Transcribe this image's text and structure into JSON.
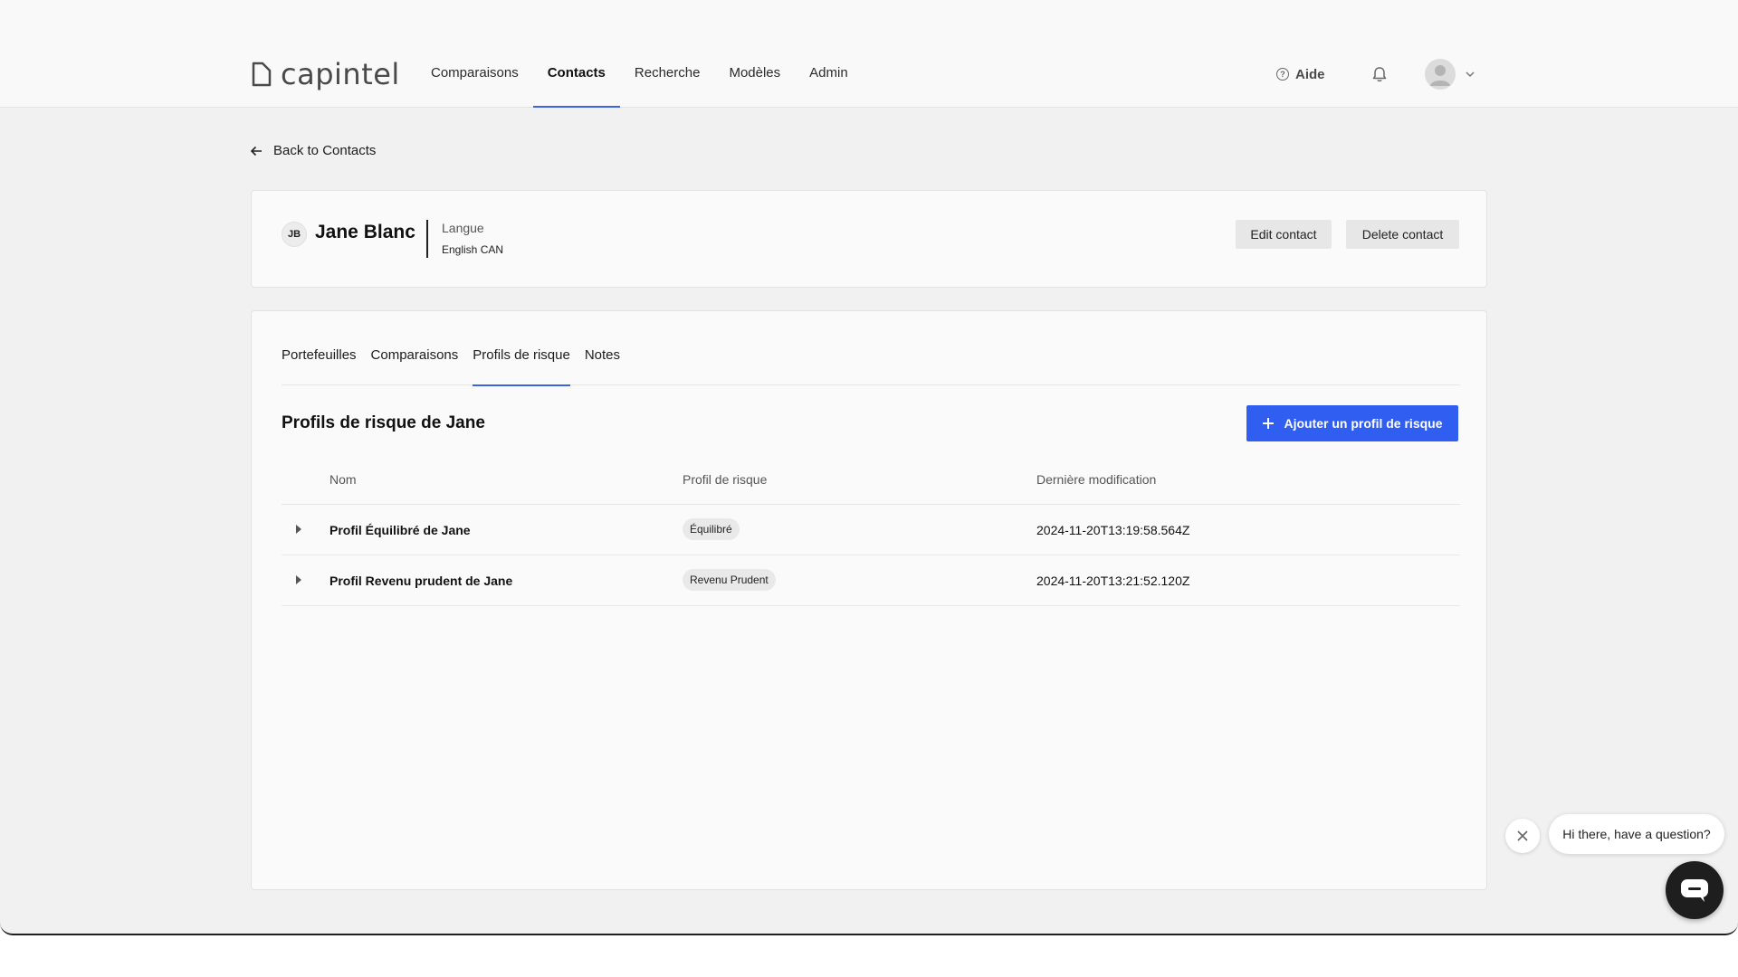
{
  "brand": {
    "name": "capintel"
  },
  "nav": {
    "items": [
      {
        "label": "Comparaisons",
        "active": false
      },
      {
        "label": "Contacts",
        "active": true
      },
      {
        "label": "Recherche",
        "active": false
      },
      {
        "label": "Modèles",
        "active": false
      },
      {
        "label": "Admin",
        "active": false
      }
    ]
  },
  "header_right": {
    "help_label": "Aide",
    "help_icon": "question-icon",
    "notify_icon": "bell-icon"
  },
  "back_link": {
    "label": "Back to Contacts",
    "icon": "arrow-left-icon"
  },
  "contact": {
    "initials": "JB",
    "name": "Jane Blanc",
    "language_label": "Langue",
    "language_value": "English CAN",
    "edit_label": "Edit contact",
    "delete_label": "Delete contact"
  },
  "tabs": [
    {
      "label": "Portefeuilles",
      "active": false
    },
    {
      "label": "Comparaisons",
      "active": false
    },
    {
      "label": "Profils de risque",
      "active": true
    },
    {
      "label": "Notes",
      "active": false
    }
  ],
  "section": {
    "title": "Profils de risque de Jane",
    "add_button_label": "Ajouter un profil de risque"
  },
  "table": {
    "headers": {
      "name": "Nom",
      "profile": "Profil de risque",
      "modified": "Dernière modification"
    },
    "rows": [
      {
        "name": "Profil Équilibré de Jane",
        "profile": "Équilibré",
        "modified": "2024-11-20T13:19:58.564Z"
      },
      {
        "name": "Profil Revenu prudent de Jane",
        "profile": "Revenu Prudent",
        "modified": "2024-11-20T13:21:52.120Z"
      }
    ]
  },
  "chat": {
    "message": "Hi there, have a question?"
  },
  "colors": {
    "accent": "#3b63e0",
    "primary_button": "#2f5ef0",
    "chat_button": "#1e1e1e"
  }
}
